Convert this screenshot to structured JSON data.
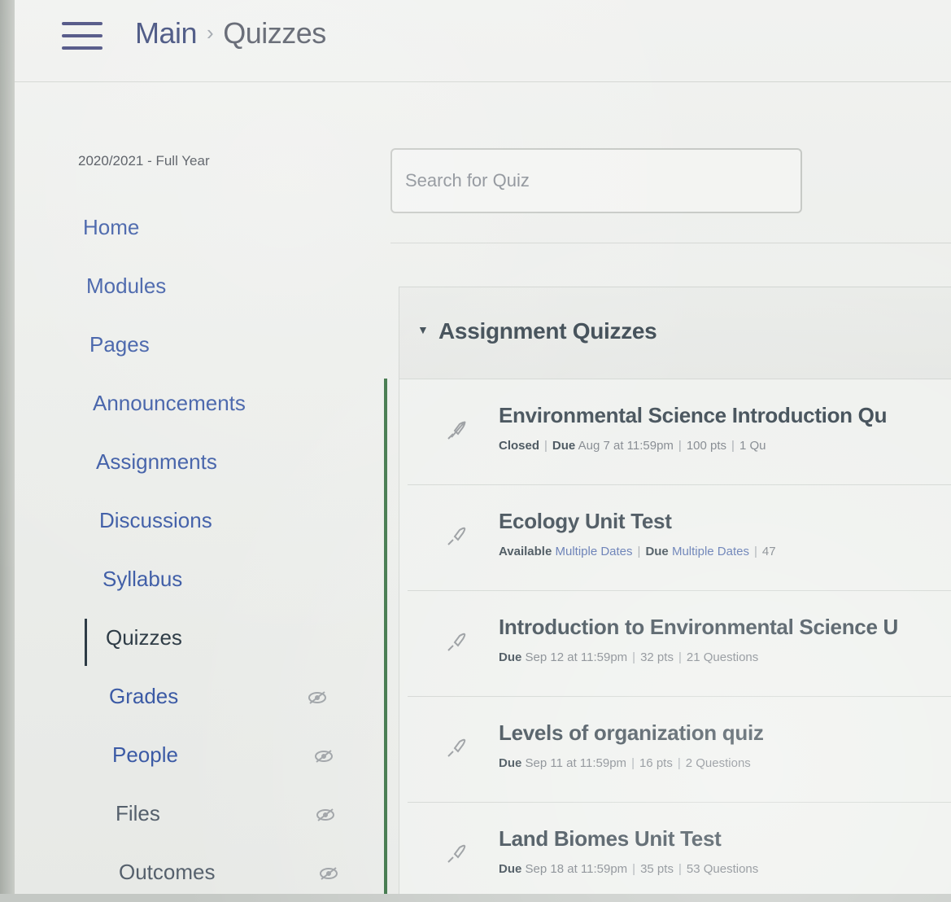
{
  "header": {
    "menu_icon": "hamburger-menu-icon",
    "breadcrumb_root": "Main",
    "breadcrumb_separator": "›",
    "breadcrumb_current": "Quizzes"
  },
  "sidebar": {
    "term": "2020/2021 - Full Year",
    "items": [
      {
        "label": "Home",
        "active": false
      },
      {
        "label": "Modules",
        "active": false
      },
      {
        "label": "Pages",
        "active": false
      },
      {
        "label": "Announcements",
        "active": false
      },
      {
        "label": "Assignments",
        "active": false
      },
      {
        "label": "Discussions",
        "active": false
      },
      {
        "label": "Syllabus",
        "active": false
      },
      {
        "label": "Quizzes",
        "active": true
      },
      {
        "label": "Grades",
        "active": false,
        "icon": "eye-icon"
      },
      {
        "label": "People",
        "active": false,
        "icon": "eye-icon"
      },
      {
        "label": "Files",
        "active": false,
        "icon": "eye-icon"
      },
      {
        "label": "Outcomes",
        "active": false,
        "icon": "eye-icon"
      }
    ]
  },
  "search": {
    "placeholder": "Search for Quiz"
  },
  "quiz_group": {
    "title": "Assignment Quizzes",
    "toggle_icon": "caret-down-icon",
    "quizzes": [
      {
        "title": "Environmental Science Introduction Qu",
        "status": "Closed",
        "due_label": "Due",
        "due": "Aug 7 at 11:59pm",
        "points": "100 pts",
        "questions": "1 Qu",
        "icon": "rocket-quiz-icon"
      },
      {
        "title": "Ecology Unit Test",
        "status": "Available",
        "availability": "Multiple Dates",
        "due_label": "Due",
        "due": "Multiple Dates",
        "points": "47",
        "icon": "rocket-quiz-icon"
      },
      {
        "title": "Introduction to Environmental Science U",
        "due_label": "Due",
        "due": "Sep 12 at 11:59pm",
        "points": "32 pts",
        "questions": "21 Questions",
        "icon": "rocket-quiz-icon"
      },
      {
        "title": "Levels of organization quiz",
        "due_label": "Due",
        "due": "Sep 11 at 11:59pm",
        "points": "16 pts",
        "questions": "2 Questions",
        "icon": "rocket-quiz-icon"
      },
      {
        "title": "Land Biomes Unit Test",
        "due_label": "Due",
        "due": "Sep 18 at 11:59pm",
        "points": "35 pts",
        "questions": "53 Questions",
        "icon": "rocket-quiz-icon"
      }
    ]
  },
  "colors": {
    "link": "#3b5aa5",
    "text": "#2d3b45",
    "active_bar": "#2f6b3a"
  }
}
